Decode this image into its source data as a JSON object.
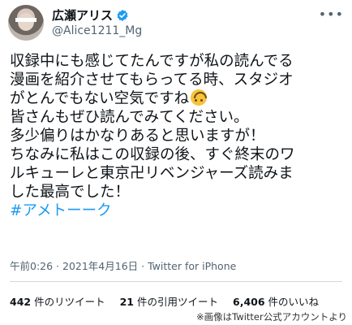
{
  "author": {
    "display_name": "広瀬アリス",
    "handle": "@Alice1211_Mg"
  },
  "tweet": {
    "lines": [
      "収録中にも感じてたんですが私の読んでる",
      "漫画を紹介させてもらってる時、スタジオ",
      "がとんでもない空気ですね",
      "皆さんもぜひ読んでみてください。",
      "多少偏りはかなりあると思いますが！",
      "ちなみに私はこの収録の後、すぐ終末のワ",
      "ルキューレと東京卍リベンジャーズ読みま",
      "した最高でした！"
    ],
    "hashtag": "#アメトーーク",
    "emoji_name": "upside-down-face"
  },
  "meta": {
    "timestamp": "午前0:26 · 2021年4月16日 · Twitter for iPhone"
  },
  "stats": {
    "retweets_count": "442",
    "retweets_label": "件のリツイート",
    "quotes_count": "21",
    "quotes_label": "件の引用ツイート",
    "likes_count": "6,406",
    "likes_label": "件のいいね"
  },
  "credit": "※画像はTwitter公式アカウントより",
  "colors": {
    "link": "#1d9bf0",
    "secondary_text": "#536471",
    "verified": "#1d9bf0"
  }
}
